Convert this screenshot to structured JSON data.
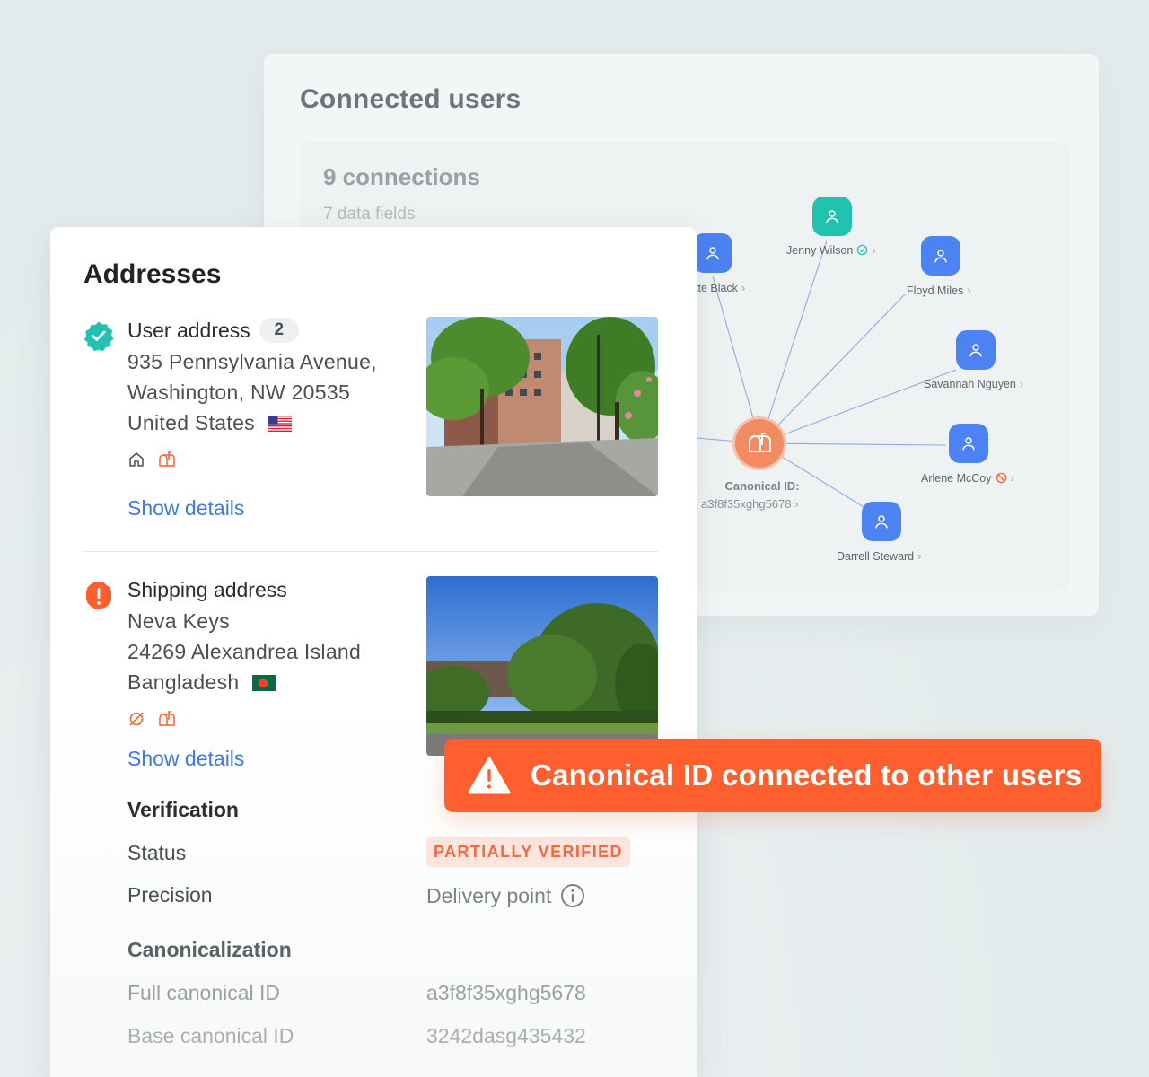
{
  "connected_users": {
    "title": "Connected users",
    "count_label": "9 connections",
    "fields_label": "7 data fields",
    "hub": {
      "label": "Canonical ID:",
      "id": "a3f8f35xghg5678"
    },
    "nodes": [
      {
        "name": "tte Black",
        "color": "#4d82f2",
        "status": "none"
      },
      {
        "name": "Jenny Wilson",
        "color": "#22c2b0",
        "status": "verified"
      },
      {
        "name": "Floyd Miles",
        "color": "#4d82f2",
        "status": "none"
      },
      {
        "name": "Savannah Nguyen",
        "color": "#4d82f2",
        "status": "none"
      },
      {
        "name": "Arlene McCoy",
        "color": "#4d82f2",
        "status": "blocked"
      },
      {
        "name": "Darrell Steward",
        "color": "#4d82f2",
        "status": "none"
      }
    ]
  },
  "addresses": {
    "title": "Addresses",
    "user_address": {
      "label": "User address",
      "count": "2",
      "status_icon": "verified-check-icon",
      "line1": "935 Pennsylvania Avenue,",
      "line2": "Washington, NW 20535",
      "country": "United States",
      "flag": "us-flag-icon",
      "icons": [
        "home-icon",
        "mailbox-icon"
      ],
      "link": "Show details"
    },
    "shipping_address": {
      "label": "Shipping address",
      "status_icon": "warning-icon",
      "line1": "Neva Keys",
      "line2": "24269 Alexandrea Island",
      "country": "Bangladesh",
      "flag": "bd-flag-icon",
      "icons": [
        "not-residential-icon",
        "mailbox-icon"
      ],
      "link": "Show details"
    },
    "verification": {
      "heading": "Verification",
      "status_key": "Status",
      "status_value": "PARTIALLY VERIFIED",
      "precision_key": "Precision",
      "precision_value": "Delivery point"
    },
    "canonicalization": {
      "heading": "Canonicalization",
      "full_key": "Full canonical ID",
      "full_value": "a3f8f35xghg5678",
      "base_key": "Base canonical ID",
      "base_value": "3242dasg435432"
    }
  },
  "toast": {
    "text": "Canonical ID connected to other users",
    "icon": "warning-triangle-icon",
    "color": "#ff5f2e"
  },
  "colors": {
    "accent_blue": "#3d7ae6",
    "verified_teal": "#22c2b0",
    "warning_orange": "#ff5f2e",
    "node_blue": "#4d82f2"
  }
}
